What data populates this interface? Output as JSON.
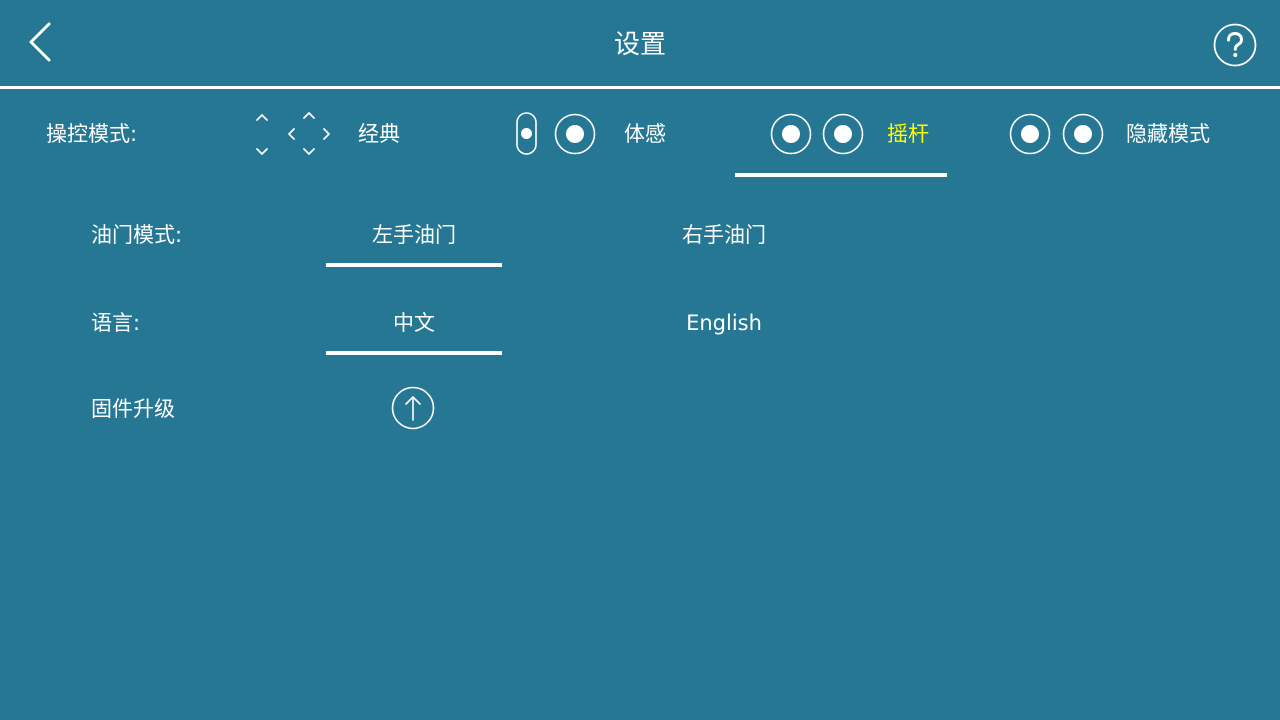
{
  "header": {
    "title": "设置",
    "back_icon": "chevron-left-icon",
    "help_icon": "question-circle-icon"
  },
  "control_mode": {
    "label": "操控模式:",
    "options": [
      {
        "label": "经典",
        "icon": "dpad-arrows-icon",
        "selected": false
      },
      {
        "label": "体感",
        "icon": "gravity-sensor-icon",
        "selected": false
      },
      {
        "label": "摇杆",
        "icon": "dual-joystick-icon",
        "selected": true
      },
      {
        "label": "隐藏模式",
        "icon": "hidden-joystick-icon",
        "selected": false
      }
    ]
  },
  "throttle_mode": {
    "label": "油门模式:",
    "options": [
      {
        "label": "左手油门",
        "selected": true
      },
      {
        "label": "右手油门",
        "selected": false
      }
    ]
  },
  "language": {
    "label": "语言:",
    "options": [
      {
        "label": "中文",
        "selected": true
      },
      {
        "label": "English",
        "selected": false
      }
    ]
  },
  "firmware": {
    "label": "固件升级",
    "icon": "upload-arrow-icon"
  },
  "colors": {
    "background": "#267793",
    "text": "#ffffff",
    "selected_highlight": "#ffff00"
  }
}
